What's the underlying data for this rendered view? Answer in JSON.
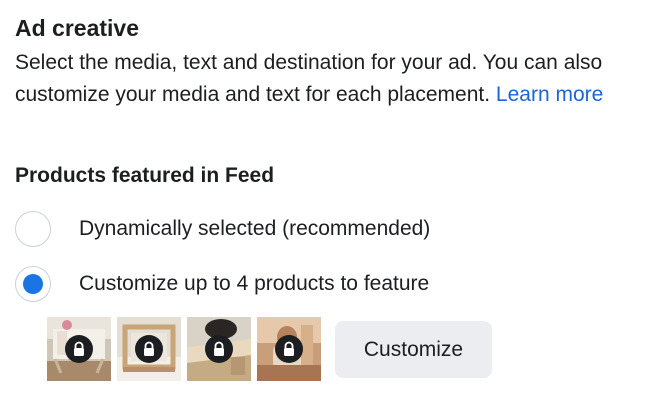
{
  "ad_creative": {
    "title": "Ad creative",
    "description": "Select the media, text and destination for your ad. You can also customize your media and text for each placement.",
    "learn_more": "Learn more"
  },
  "products_featured": {
    "heading": "Products featured in Feed",
    "options": [
      {
        "label": "Dynamically selected (recommended)",
        "selected": false
      },
      {
        "label": "Customize up to 4 products to feature",
        "selected": true
      }
    ],
    "thumbnails": [
      {
        "icon": "lock-icon",
        "locked": true
      },
      {
        "icon": "lock-icon",
        "locked": true
      },
      {
        "icon": "lock-icon",
        "locked": true
      },
      {
        "icon": "lock-icon",
        "locked": true
      }
    ],
    "customize_button": "Customize"
  },
  "colors": {
    "link": "#1a66d6",
    "radio_selected": "#1b74e4",
    "button_bg": "#ebedf0",
    "text": "#1c1e21"
  }
}
